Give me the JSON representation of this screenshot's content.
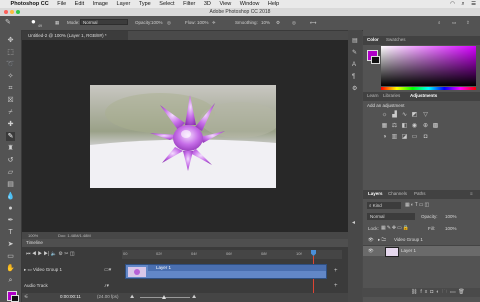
{
  "menubar": {
    "app_name": "Photoshop CC",
    "items": [
      "File",
      "Edit",
      "Image",
      "Layer",
      "Type",
      "Select",
      "Filter",
      "3D",
      "View",
      "Window",
      "Help"
    ]
  },
  "window": {
    "title": "Adobe Photoshop CC 2018"
  },
  "options": {
    "mode_label": "Mode:",
    "mode_value": "Normal",
    "opacity_label": "Opacity:",
    "opacity_value": "100%",
    "flow_label": "Flow:",
    "flow_value": "100%",
    "smoothing_label": "Smoothing:",
    "smoothing_value": "10%",
    "brush_size": "49"
  },
  "document": {
    "tab_title": "Untitled-2 @ 100% (Layer 1, RGB/8#) *",
    "zoom": "100%",
    "doc_size": "Doc: 1.48M/1.48M"
  },
  "timeline": {
    "title": "Timeline",
    "ticks": [
      "00",
      "02f",
      "04f",
      "06f",
      "08f",
      "10f"
    ],
    "group_name": "Video Group 1",
    "clip_name": "Layer 1",
    "audio_label": "Audio Track",
    "timecode": "0:00:00:11",
    "fps": "(24.00 fps)"
  },
  "color_panel": {
    "tab_color": "Color",
    "tab_swatches": "Swatches",
    "fg_color": "#b000c8",
    "bg_color": "#111111"
  },
  "adjust_panel": {
    "tab_learn": "Learn",
    "tab_libraries": "Libraries",
    "tab_adjustments": "Adjustments",
    "add_label": "Add an adjustment"
  },
  "layers_panel": {
    "tab_layers": "Layers",
    "tab_channels": "Channels",
    "tab_paths": "Paths",
    "kind_label": "Kind",
    "blend_mode": "Normal",
    "opacity_label": "Opacity:",
    "opacity_value": "100%",
    "lock_label": "Lock:",
    "fill_label": "Fill:",
    "fill_value": "100%",
    "layers": [
      {
        "name": "Video Group 1"
      },
      {
        "name": "Layer 1"
      }
    ]
  }
}
